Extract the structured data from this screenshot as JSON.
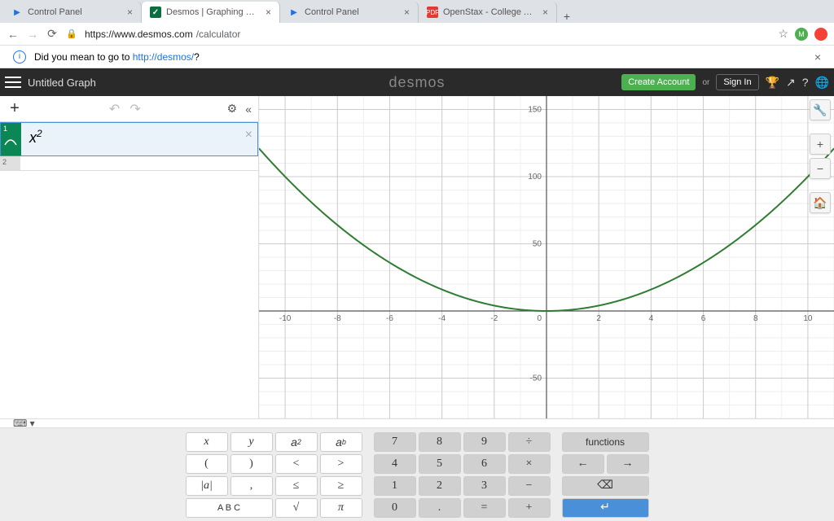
{
  "browser": {
    "tabs": [
      {
        "title": "Control Panel",
        "favicon": "play"
      },
      {
        "title": "Desmos | Graphing Calculator",
        "favicon": "desmos",
        "active": true
      },
      {
        "title": "Control Panel",
        "favicon": "play"
      },
      {
        "title": "OpenStax - College Algebra-C",
        "favicon": "pdf"
      }
    ],
    "url_host": "https://www.desmos.com",
    "url_path": "/calculator",
    "info_text": "Did you mean to go to ",
    "info_link": "http://desmos/",
    "info_tail": "?"
  },
  "header": {
    "title": "Untitled Graph",
    "brand": "desmos",
    "create": "Create Account",
    "or": "or",
    "signin": "Sign In"
  },
  "expressions": [
    {
      "num": "1",
      "value": "x",
      "sup": "2",
      "active": true
    },
    {
      "num": "2",
      "value": "",
      "active": false
    }
  ],
  "chart_data": {
    "type": "line",
    "series": [
      {
        "name": "x^2",
        "expr": "y = x^2"
      }
    ],
    "xlim": [
      -11,
      11
    ],
    "ylim": [
      -80,
      160
    ],
    "xticks": [
      -10,
      -8,
      -6,
      -4,
      -2,
      0,
      2,
      4,
      6,
      8,
      10
    ],
    "yticks": [
      -50,
      50,
      100,
      150
    ],
    "grid": true
  },
  "keypad": {
    "g1": [
      [
        "x",
        "y",
        "a²",
        "aᵇ"
      ],
      [
        "(",
        ")",
        "<",
        ">"
      ],
      [
        "|a|",
        ",",
        "≤",
        "≥"
      ],
      [
        "A B C",
        "√",
        "π"
      ]
    ],
    "g2": [
      [
        "7",
        "8",
        "9",
        "÷"
      ],
      [
        "4",
        "5",
        "6",
        "×"
      ],
      [
        "1",
        "2",
        "3",
        "−"
      ],
      [
        "0",
        ".",
        "=",
        "+"
      ]
    ],
    "g3": [
      [
        "functions"
      ],
      [
        "←",
        "→"
      ],
      [
        "⌫"
      ],
      [
        "↵"
      ]
    ]
  }
}
